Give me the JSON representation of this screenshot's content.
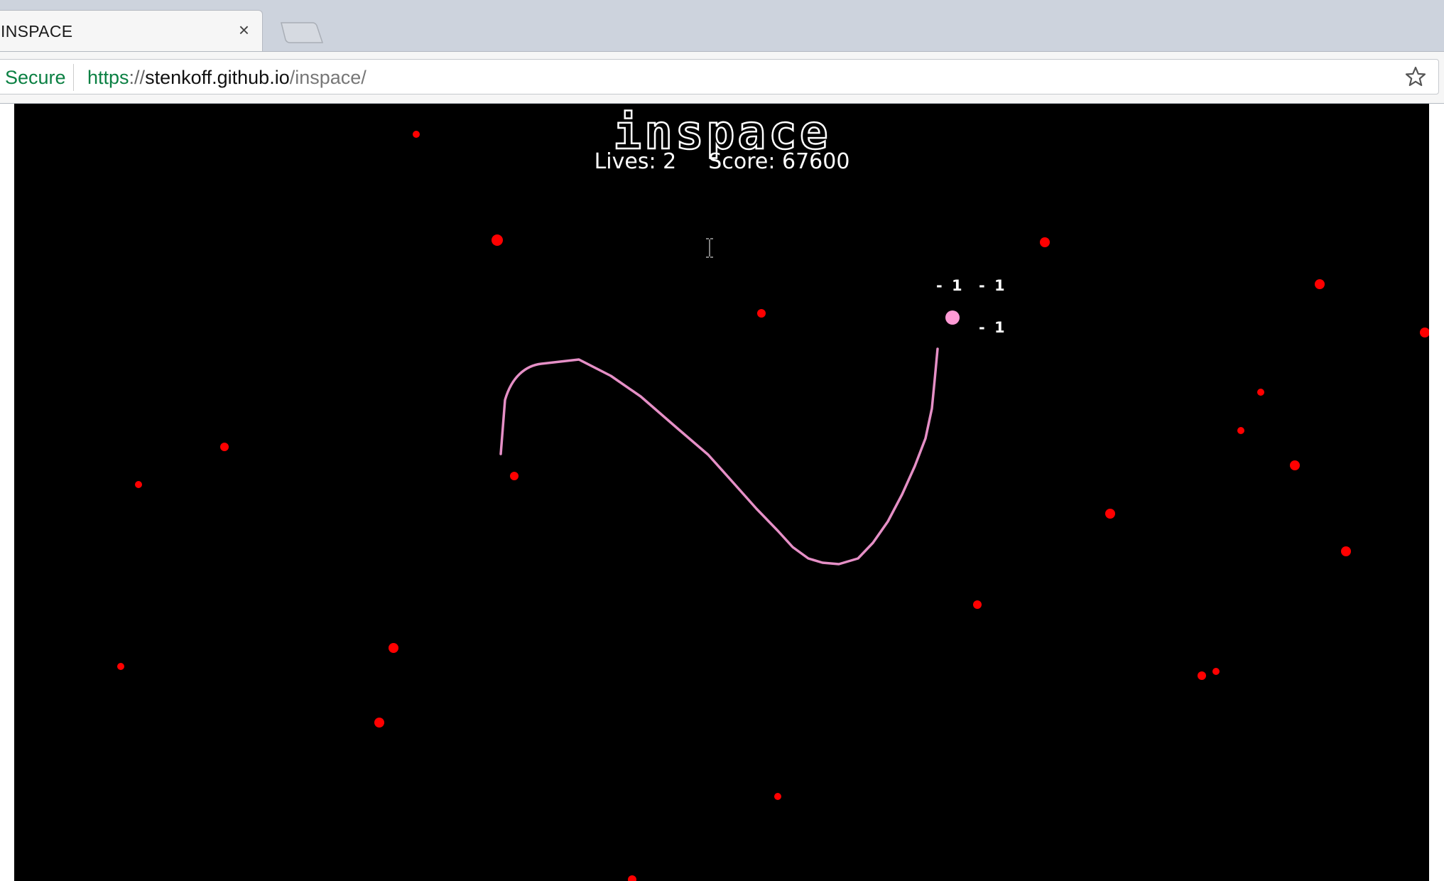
{
  "browser": {
    "tab_title": "INSPACE",
    "tab_close_glyph": "×",
    "secure_label": "Secure",
    "url": {
      "scheme": "https",
      "separator": "://",
      "host": "stenkoff.github.io",
      "path": "/inspace/"
    },
    "icons": {
      "close": "close-icon",
      "new_tab": "new-tab-icon",
      "bookmark": "star-icon"
    }
  },
  "game": {
    "title": "inspace",
    "lives_label": "Lives:",
    "lives": "2",
    "score_label": "Score:",
    "score": "67600",
    "score_popups": [
      "- 1",
      "- 1",
      "- 1"
    ],
    "colors": {
      "background": "#000000",
      "dot": "#ff0000",
      "trail": "#e58fc6",
      "player": "#ff9ad5",
      "text": "#ffffff"
    }
  }
}
